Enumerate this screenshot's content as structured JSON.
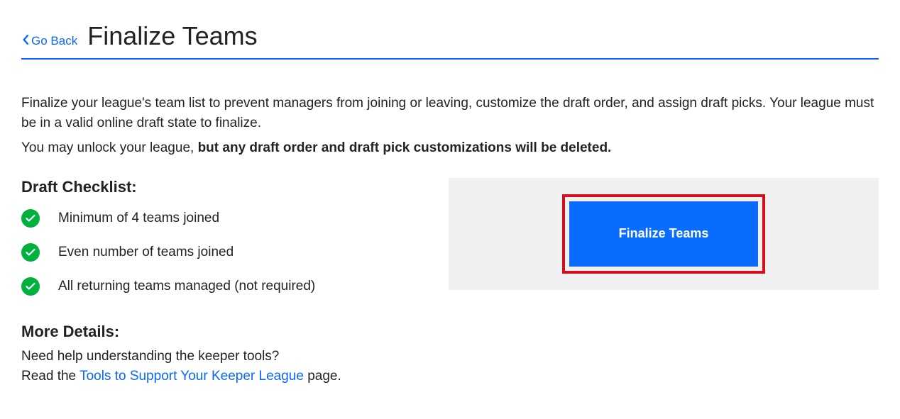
{
  "header": {
    "go_back_label": "Go Back",
    "page_title": "Finalize Teams"
  },
  "intro": {
    "p1": "Finalize your league's team list to prevent managers from joining or leaving, customize the draft order, and assign draft picks. Your league must be in a valid online draft state to finalize.",
    "p2_prefix": "You may unlock your league, ",
    "p2_bold": "but any draft order and draft pick customizations will be deleted."
  },
  "checklist": {
    "heading": "Draft Checklist:",
    "items": {
      "0": "Minimum of 4 teams joined",
      "1": "Even number of teams joined",
      "2": "All returning teams managed (not required)"
    }
  },
  "more_details": {
    "heading": "More Details:",
    "q": "Need help understanding the keeper tools?",
    "read_prefix": "Read the ",
    "link_text": "Tools to Support Your Keeper League",
    "read_suffix": " page."
  },
  "action": {
    "finalize_button_label": "Finalize Teams"
  }
}
